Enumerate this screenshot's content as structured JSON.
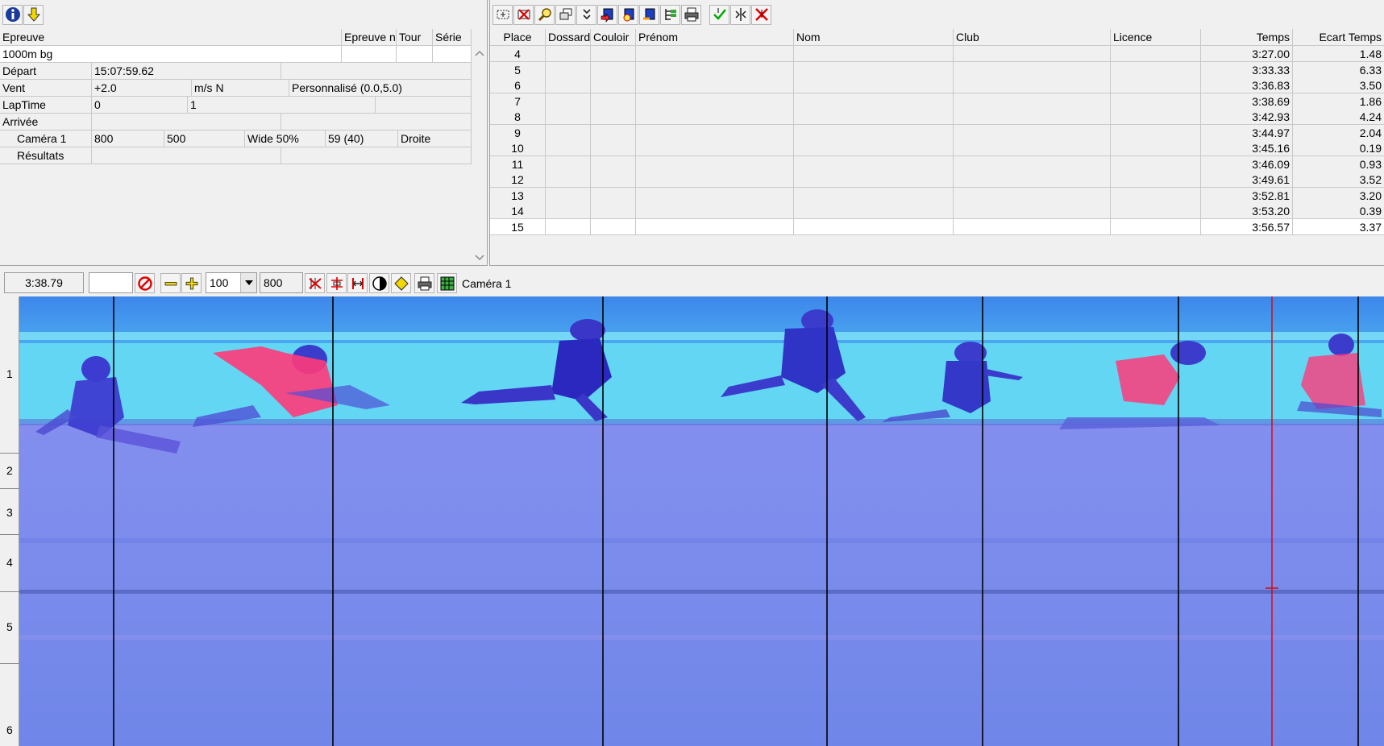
{
  "left_panel": {
    "headers": {
      "epreuve": "Epreuve",
      "epreuve_n": "Epreuve n",
      "tour": "Tour",
      "serie": "Série"
    },
    "epreuve_value": "1000m bg",
    "depart": {
      "label": "Départ",
      "value": "15:07:59.62"
    },
    "vent": {
      "label": "Vent",
      "value": "+2.0",
      "unit": "m/s N",
      "mode": "Personnalisé (0.0,5.0)"
    },
    "laptime": {
      "label": "LapTime",
      "value1": "0",
      "value2": "1"
    },
    "arrivee": {
      "label": "Arrivée"
    },
    "camera": {
      "label": "Caméra 1",
      "v1": "800",
      "v2": "500",
      "v3": "Wide 50%",
      "v4": "59  (40)",
      "v5": "Droite"
    },
    "resultats": {
      "label": "Résultats"
    }
  },
  "results": {
    "columns": [
      "Place",
      "Dossard",
      "Couloir",
      "Prénom",
      "Nom",
      "Club",
      "Licence",
      "Temps",
      "Ecart Temps"
    ],
    "rows": [
      {
        "place": "4",
        "temps": "3:27.00",
        "ecart": "1.48"
      },
      {
        "place": "5",
        "temps": "3:33.33",
        "ecart": "6.33"
      },
      {
        "place": "6",
        "temps": "3:36.83",
        "ecart": "3.50"
      },
      {
        "place": "7",
        "temps": "3:38.69",
        "ecart": "1.86"
      },
      {
        "place": "8",
        "temps": "3:42.93",
        "ecart": "4.24"
      },
      {
        "place": "9",
        "temps": "3:44.97",
        "ecart": "2.04"
      },
      {
        "place": "10",
        "temps": "3:45.16",
        "ecart": "0.19"
      },
      {
        "place": "11",
        "temps": "3:46.09",
        "ecart": "0.93"
      },
      {
        "place": "12",
        "temps": "3:49.61",
        "ecart": "3.52"
      },
      {
        "place": "13",
        "temps": "3:52.81",
        "ecart": "3.20"
      },
      {
        "place": "14",
        "temps": "3:53.20",
        "ecart": "0.39"
      },
      {
        "place": "15",
        "temps": "3:56.57",
        "ecart": "3.37"
      }
    ]
  },
  "viewer": {
    "time_display": "3:38.79",
    "empty_field": "",
    "zoom_value": "100",
    "width_value": "800",
    "camera_label": "Caméra 1",
    "lanes": [
      "1",
      "2",
      "3",
      "4",
      "5",
      "6"
    ]
  },
  "colors": {
    "accent_red": "#e00000",
    "photo_blue": "#6f86e8",
    "lane_cyan": "#62d6f2"
  }
}
